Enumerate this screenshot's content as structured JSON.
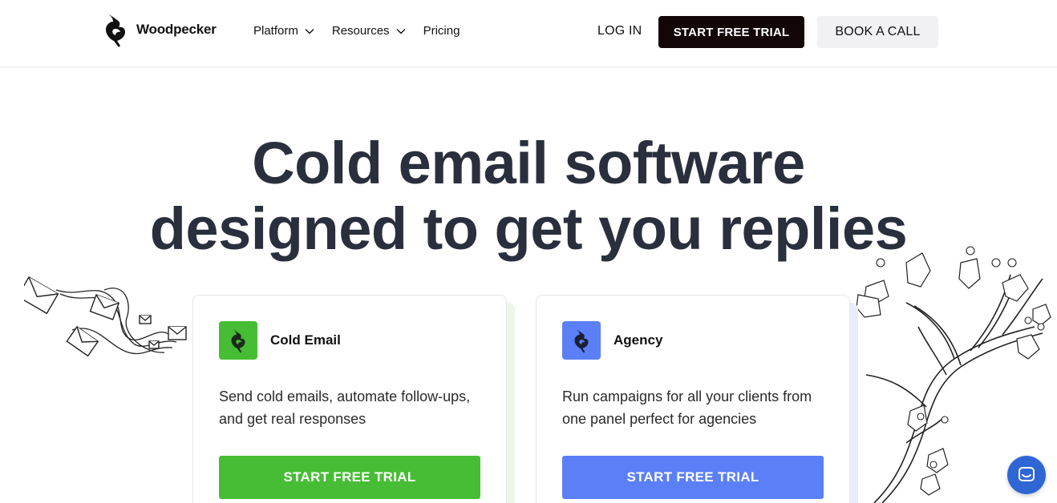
{
  "header": {
    "brand": "Woodpecker",
    "nav": [
      {
        "label": "Platform",
        "has_dropdown": true
      },
      {
        "label": "Resources",
        "has_dropdown": true
      },
      {
        "label": "Pricing",
        "has_dropdown": false
      }
    ],
    "login_label": "LOG IN",
    "trial_label": "START FREE TRIAL",
    "call_label": "BOOK A CALL"
  },
  "hero": {
    "title_line1": "Cold email software",
    "title_line2": "designed to get you replies"
  },
  "cards": [
    {
      "title": "Cold Email",
      "description": "Send cold emails, automate follow-ups, and get real responses",
      "button": "START FREE TRIAL",
      "accent": "#46bd34",
      "icon": "woodpecker-logo-icon"
    },
    {
      "title": "Agency",
      "description": "Run campaigns for all your clients from one panel perfect for agencies",
      "button": "START FREE TRIAL",
      "accent": "#5b7ff7",
      "icon": "woodpecker-logo-icon"
    }
  ],
  "colors": {
    "heading": "#2a2f3d",
    "dark_button": "#120606",
    "chat_button": "#2f66d6"
  },
  "icons": {
    "chat": "chat-bubble-icon",
    "dropdown": "chevron-down-icon",
    "left_illustration": "flying-envelopes-icon",
    "right_illustration": "tree-branch-icon"
  }
}
